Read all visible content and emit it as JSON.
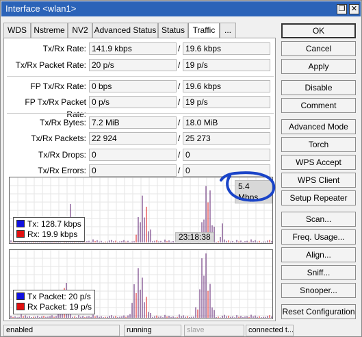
{
  "window": {
    "title": "Interface <wlan1>",
    "restore_glyph": "❐",
    "close_glyph": "✕"
  },
  "tabs": [
    "WDS",
    "Nstreme",
    "NV2",
    "Advanced Status",
    "Status",
    "Traffic",
    "..."
  ],
  "active_tab": "Traffic",
  "traffic": {
    "tx_rx_rate": {
      "label": "Tx/Rx Rate:",
      "tx": "141.9 kbps",
      "rx": "19.6 kbps"
    },
    "tx_rx_packet_rate": {
      "label": "Tx/Rx Packet Rate:",
      "tx": "20 p/s",
      "rx": "19 p/s"
    },
    "fp_tx_rx_rate": {
      "label": "FP Tx/Rx Rate:",
      "tx": "0 bps",
      "rx": "19.6 kbps"
    },
    "fp_tx_rx_packet_rate": {
      "label": "FP Tx/Rx Packet Rate:",
      "tx": "0 p/s",
      "rx": "19 p/s"
    },
    "tx_rx_bytes": {
      "label": "Tx/Rx Bytes:",
      "tx": "7.2 MiB",
      "rx": "18.0 MiB"
    },
    "tx_rx_packets": {
      "label": "Tx/Rx Packets:",
      "tx": "22 924",
      "rx": "25 273"
    },
    "tx_rx_drops": {
      "label": "Tx/Rx Drops:",
      "tx": "0",
      "rx": "0"
    },
    "tx_rx_errors": {
      "label": "Tx/Rx Errors:",
      "tx": "0",
      "rx": "0"
    },
    "separator": "/"
  },
  "graph_bits": {
    "max_label": "5.4 Mbps",
    "time_label": "23:18:38",
    "tx_legend": "Tx:  128.7 kbps",
    "rx_legend": "Rx:  19.9 kbps"
  },
  "graph_packets": {
    "tx_legend": "Tx Packet:  20 p/s",
    "rx_legend": "Rx Packet:  19 p/s"
  },
  "colors": {
    "tx": "#1010e0",
    "rx": "#e01010",
    "annotation": "#1a44c8",
    "title_bar": "#2b63b8"
  },
  "buttons": [
    "OK",
    "Cancel",
    "Apply",
    "Disable",
    "Comment",
    "Advanced Mode",
    "Torch",
    "WPS Accept",
    "WPS Client",
    "Setup Repeater",
    "Scan...",
    "Freq. Usage...",
    "Align...",
    "Sniff...",
    "Snooper...",
    "Reset Configuration"
  ],
  "status_bar": {
    "state": "enabled",
    "run": "running",
    "mode": "slave",
    "conn": "connected t..."
  }
}
